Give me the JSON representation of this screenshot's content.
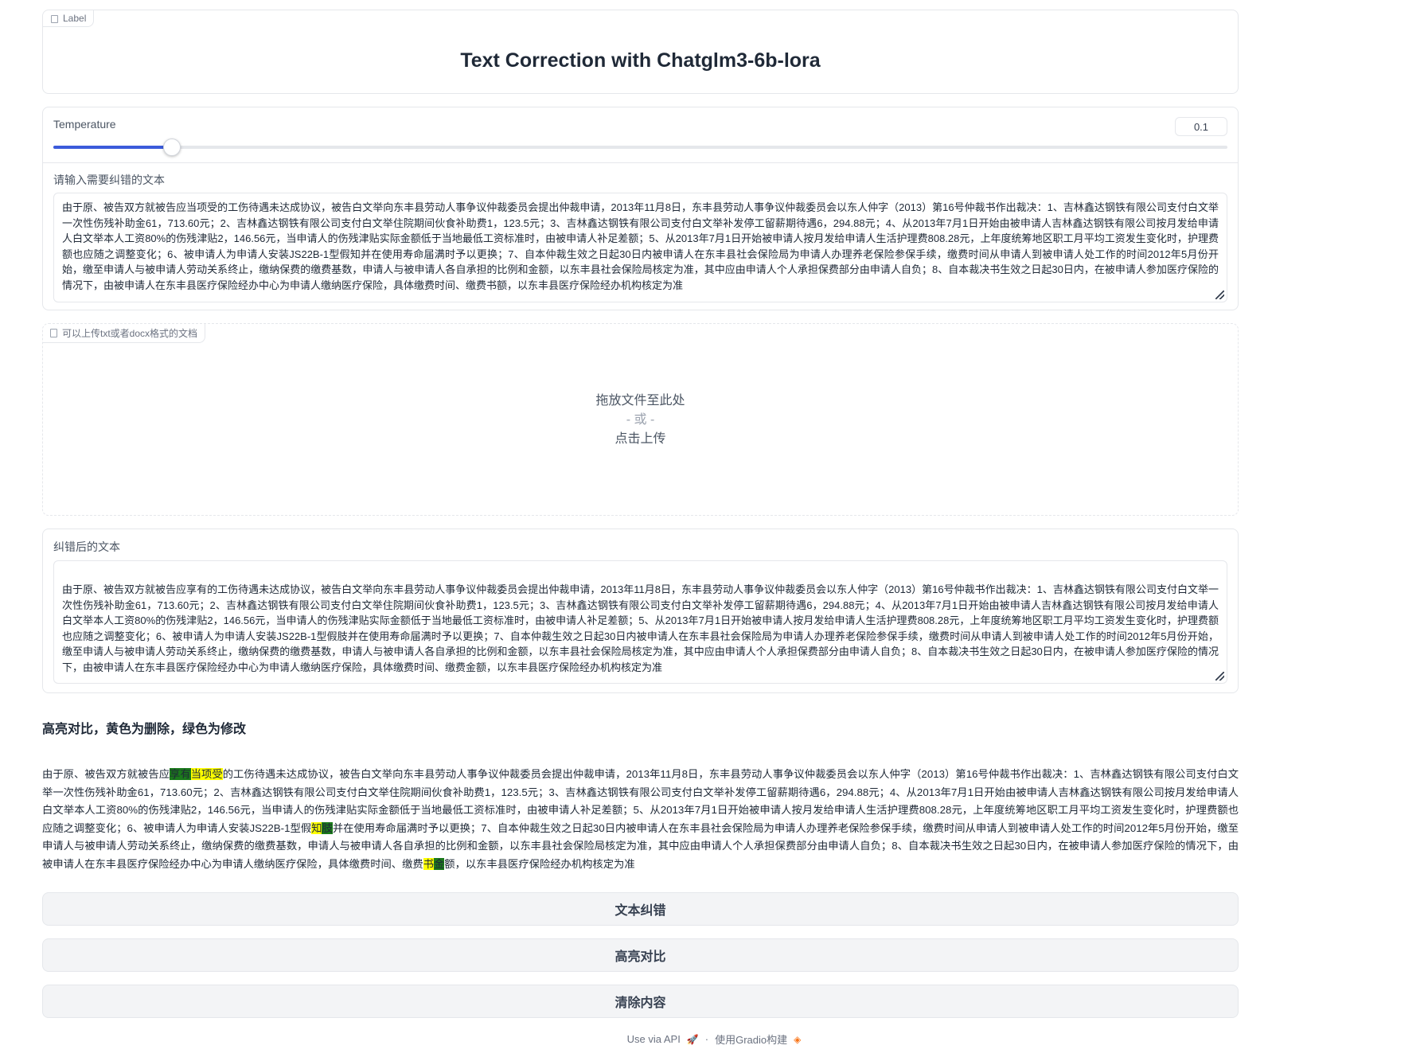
{
  "title_block": {
    "label": "Label",
    "title": "Text Correction with Chatglm3-6b-lora"
  },
  "temperature": {
    "label": "Temperature",
    "value": "0.1",
    "fraction": 0.1
  },
  "input": {
    "label": "请输入需要纠错的文本",
    "text": "由于原、被告双方就被告应当项受的工伤待遇未达成协议，被告白文举向东丰县劳动人事争议仲裁委员会提出仲裁申请，2013年11月8日，东丰县劳动人事争议仲裁委员会以东人仲字（2013）第16号仲裁书作出裁决：1、吉林鑫达钢铁有限公司支付白文举一次性伤残补助金61，713.60元；2、吉林鑫达钢铁有限公司支付白文举住院期间伙食补助费1，123.5元；3、吉林鑫达钢铁有限公司支付白文举补发停工留薪期待遇6，294.88元；4、从2013年7月1日开始由被申请人吉林鑫达钢铁有限公司按月发给申请人白文举本人工资80%的伤残津贴2，146.56元，当申请人的伤残津贴实际金额低于当地最低工资标准时，由被申请人补足差额；5、从2013年7月1日开始被申请人按月发给申请人生活护理费808.28元，上年度统筹地区职工月平均工资发生变化时，护理费额也应随之调整变化；6、被申请人为申请人安装JS22B-1型假知并在使用寿命届满时予以更换；7、自本仲裁生效之日起30日内被申请人在东丰县社会保险局为申请人办理养老保险参保手续，缴费时间从申请人到被申请人处工作的时间2012年5月份开始，缴至申请人与被申请人劳动关系终止，缴纳保费的缴费基数，申请人与被申请人各自承担的比例和金额，以东丰县社会保险局核定为准，其中应由申请人个人承担保费部分由申请人自负；8、自本裁决书生效之日起30日内，在被申请人参加医疗保险的情况下，由被申请人在东丰县医疗保险经办中心为申请人缴纳医疗保险，具体缴费时间、缴费书额，以东丰县医疗保险经办机构核定为准"
  },
  "upload": {
    "label": "可以上传txt或者docx格式的文档",
    "drop": "拖放文件至此处",
    "or": "- 或 -",
    "click": "点击上传"
  },
  "output": {
    "label": "纠错后的文本",
    "text": "由于原、被告双方就被告应享有的工伤待遇未达成协议，被告白文举向东丰县劳动人事争议仲裁委员会提出仲裁申请，2013年11月8日，东丰县劳动人事争议仲裁委员会以东人仲字（2013）第16号仲裁书作出裁决：1、吉林鑫达钢铁有限公司支付白文举一次性伤残补助金61，713.60元；2、吉林鑫达钢铁有限公司支付白文举住院期间伙食补助费1，123.5元；3、吉林鑫达钢铁有限公司支付白文举补发停工留薪期待遇6，294.88元；4、从2013年7月1日开始由被申请人吉林鑫达钢铁有限公司按月发给申请人白文举本人工资80%的伤残津贴2，146.56元，当申请人的伤残津贴实际金额低于当地最低工资标准时，由被申请人补足差额；5、从2013年7月1日开始被申请人按月发给申请人生活护理费808.28元，上年度统筹地区职工月平均工资发生变化时，护理费额也应随之调整变化；6、被申请人为申请人安装JS22B-1型假肢并在使用寿命届满时予以更换；7、自本仲裁生效之日起30日内被申请人在东丰县社会保险局为申请人办理养老保险参保手续，缴费时间从申请人到被申请人处工作的时间2012年5月份开始，缴至申请人与被申请人劳动关系终止，缴纳保费的缴费基数，申请人与被申请人各自承担的比例和金额，以东丰县社会保险局核定为准，其中应由申请人个人承担保费部分由申请人自负；8、自本裁决书生效之日起30日内，在被申请人参加医疗保险的情况下，由被申请人在东丰县医疗保险经办中心为申请人缴纳医疗保险，具体缴费时间、缴费金额，以东丰县医疗保险经办机构核定为准"
  },
  "compare": {
    "title": "高亮对比，黄色为删除，绿色为修改",
    "seg1": "由于原、被告双方就被告应",
    "g1": "享有",
    "y1": "当项受",
    "seg2": "的工伤待遇未达成协议，被告白文举向东丰县劳动人事争议仲裁委员会提出仲裁申请，2013年11月8日，东丰县劳动人事争议仲裁委员会以东人仲字（2013）第16号仲裁书作出裁决：1、吉林鑫达钢铁有限公司支付白文举一次性伤残补助金61，713.60元；2、吉林鑫达钢铁有限公司支付白文举住院期间伙食补助费1，123.5元；3、吉林鑫达钢铁有限公司支付白文举补发停工留薪期待遇6，294.88元；4、从2013年7月1日开始由被申请人吉林鑫达钢铁有限公司按月发给申请人白文举本人工资80%的伤残津贴2，146.56元，当申请人的伤残津贴实际金额低于当地最低工资标准时，由被申请人补足差额；5、从2013年7月1日开始被申请人按月发给申请人生活护理费808.28元，上年度统筹地区职工月平均工资发生变化时，护理费额也应随之调整变化；6、被申请人为申请人安装JS22B-1型假",
    "y2": "知",
    "g2": "肢",
    "seg3": "并在使用寿命届满时予以更换；7、自本仲裁生效之日起30日内被申请人在东丰县社会保险局为申请人办理养老保险参保手续，缴费时间从申请人到被申请人处工作的时间2012年5月份开始，缴至申请人与被申请人劳动关系终止，缴纳保费的缴费基数，申请人与被申请人各自承担的比例和金额，以东丰县社会保险局核定为准，其中应由申请人个人承担保费部分由申请人自负；8、自本裁决书生效之日起30日内，在被申请人参加医疗保险的情况下，由被申请人在东丰县医疗保险经办中心为申请人缴纳医疗保险，具体缴费时间、缴费",
    "y3": "书",
    "g3": "金",
    "seg4": "额，以东丰县医疗保险经办机构核定为准"
  },
  "buttons": {
    "correct": "文本纠错",
    "highlight": "高亮对比",
    "clear": "清除内容"
  },
  "footer": {
    "api": "Use via API",
    "sep": "·",
    "built": "使用Gradio构建",
    "api_icon": "rocket-icon",
    "built_icon": "gradio-logo-icon"
  },
  "colors": {
    "accent": "#3b5bdb",
    "delete_highlight": "#ffff00",
    "modify_highlight": "#1b7a1b"
  }
}
